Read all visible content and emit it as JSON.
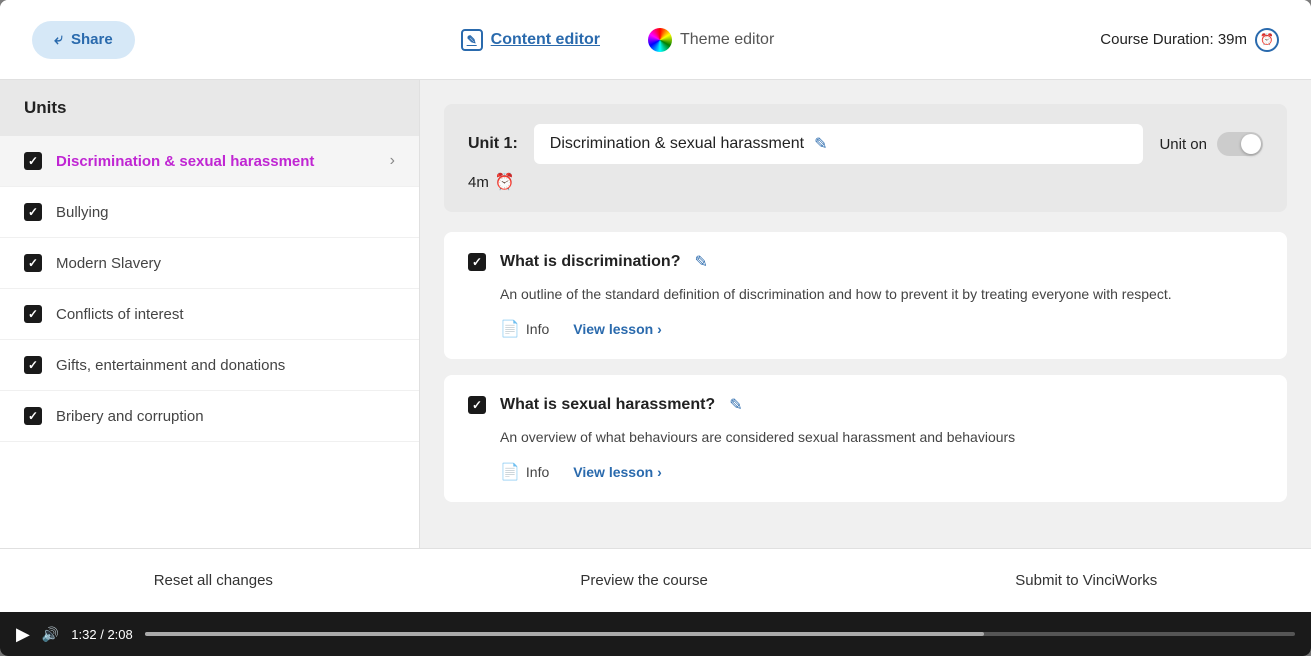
{
  "topbar": {
    "share_label": "Share",
    "content_editor_label": "Content editor",
    "theme_editor_label": "Theme editor",
    "course_duration_label": "Course Duration: 39m"
  },
  "sidebar": {
    "header": "Units",
    "items": [
      {
        "id": "unit1",
        "label": "Discrimination & sexual harassment",
        "active": true,
        "checked": true,
        "has_chevron": true
      },
      {
        "id": "unit2",
        "label": "Bullying",
        "active": false,
        "checked": true,
        "has_chevron": false
      },
      {
        "id": "unit3",
        "label": "Modern Slavery",
        "active": false,
        "checked": true,
        "has_chevron": false
      },
      {
        "id": "unit4",
        "label": "Conflicts of interest",
        "active": false,
        "checked": true,
        "has_chevron": false
      },
      {
        "id": "unit5",
        "label": "Gifts, entertainment and donations",
        "active": false,
        "checked": true,
        "has_chevron": false
      },
      {
        "id": "unit6",
        "label": "Bribery and corruption",
        "active": false,
        "checked": true,
        "has_chevron": false
      }
    ]
  },
  "unit": {
    "label": "Unit 1:",
    "title": "Discrimination & sexual harassment",
    "duration": "4m",
    "toggle_label": "Unit on",
    "toggle_on": false
  },
  "lessons": [
    {
      "id": "lesson1",
      "title": "What is discrimination?",
      "checked": true,
      "description": "An outline of the standard definition of discrimination and how to prevent it by treating everyone with respect.",
      "info_label": "Info",
      "view_label": "View lesson ›"
    },
    {
      "id": "lesson2",
      "title": "What is sexual harassment?",
      "checked": true,
      "description": "An overview of what behaviours are considered sexual harassment and behaviours",
      "info_label": "Info",
      "view_label": "View lesson ›"
    }
  ],
  "bottom": {
    "reset_label": "Reset all changes",
    "preview_label": "Preview the course",
    "submit_label": "Submit to VinciWorks"
  },
  "video": {
    "time_current": "1:32",
    "time_total": "2:08",
    "progress_pct": 73
  }
}
